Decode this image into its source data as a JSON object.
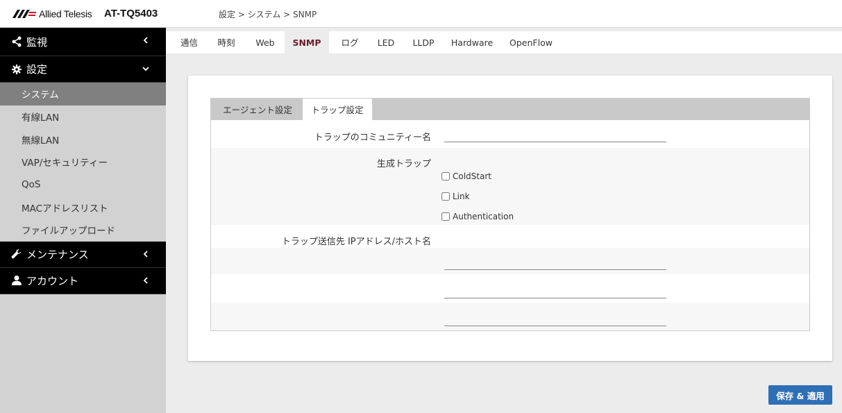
{
  "header": {
    "brand": "Allied Telesis",
    "model": "AT-TQ5403",
    "breadcrumb": "設定 > システム > SNMP"
  },
  "sidebar": {
    "sections": [
      {
        "label": "監視",
        "icon": "share-icon",
        "state": "collapsed"
      },
      {
        "label": "設定",
        "icon": "gear-icon",
        "state": "expanded"
      },
      {
        "label": "メンテナンス",
        "icon": "wrench-icon",
        "state": "collapsed"
      },
      {
        "label": "アカウント",
        "icon": "user-icon",
        "state": "collapsed"
      }
    ],
    "items": [
      {
        "label": "システム",
        "active": true
      },
      {
        "label": "有線LAN"
      },
      {
        "label": "無線LAN"
      },
      {
        "label": "VAP/セキュリティー"
      },
      {
        "label": "QoS"
      },
      {
        "label": "MACアドレスリスト"
      },
      {
        "label": "ファイルアップロード"
      }
    ]
  },
  "top_tabs": [
    {
      "label": "通信"
    },
    {
      "label": "時刻"
    },
    {
      "label": "Web"
    },
    {
      "label": "SNMP",
      "active": true
    },
    {
      "label": "ログ"
    },
    {
      "label": "LED"
    },
    {
      "label": "LLDP"
    },
    {
      "label": "Hardware"
    },
    {
      "label": "OpenFlow"
    }
  ],
  "sub_tabs": [
    {
      "label": "エージェント設定"
    },
    {
      "label": "トラップ設定",
      "active": true
    }
  ],
  "form": {
    "community_label": "トラップのコミュニティー名",
    "community_value": "",
    "traps_label": "生成トラップ",
    "traps": [
      {
        "label": "ColdStart",
        "checked": false
      },
      {
        "label": "Link",
        "checked": false
      },
      {
        "label": "Authentication",
        "checked": false
      }
    ],
    "hosts_label": "トラップ送信先 IPアドレス/ホスト名",
    "hosts": [
      "",
      "",
      ""
    ]
  },
  "save_button": "保存 & 適用",
  "colors": {
    "accent": "#6b1b2b",
    "button": "#2f6fb5",
    "sidebar_dark": "#000000",
    "sidebar_bg": "#d2d2d2",
    "active_item": "#808080"
  }
}
